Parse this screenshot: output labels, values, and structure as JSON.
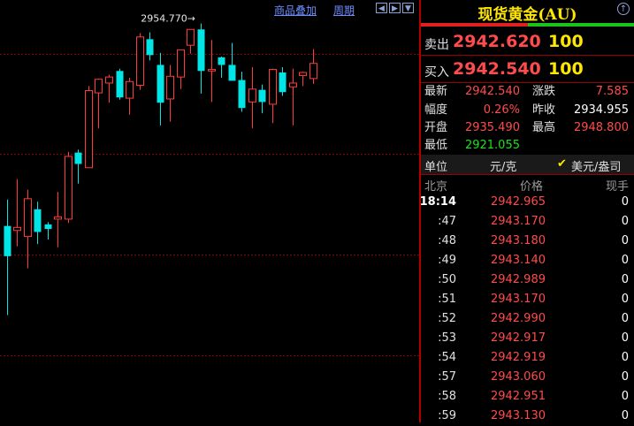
{
  "toolbar": {
    "overlay_label": "商品叠加",
    "period_label": "周期",
    "nav_left": "◀",
    "nav_right": "▶",
    "nav_down": "▼"
  },
  "chart": {
    "high_label": "2954.770→",
    "candles": [
      {
        "o": 2928.0,
        "h": 2931.5,
        "l": 2916.2,
        "c": 2924.0
      },
      {
        "o": 2927.4,
        "h": 2934.2,
        "l": 2925.3,
        "c": 2927.8
      },
      {
        "o": 2926.6,
        "h": 2932.8,
        "l": 2922.4,
        "c": 2931.6
      },
      {
        "o": 2930.2,
        "h": 2931.2,
        "l": 2925.6,
        "c": 2927.2
      },
      {
        "o": 2928.2,
        "h": 2928.5,
        "l": 2926.2,
        "c": 2927.6
      },
      {
        "o": 2928.9,
        "h": 2932.5,
        "l": 2925.2,
        "c": 2929.2
      },
      {
        "o": 2928.9,
        "h": 2937.8,
        "l": 2928.4,
        "c": 2937.2
      },
      {
        "o": 2937.7,
        "h": 2938.1,
        "l": 2933.6,
        "c": 2936.2
      },
      {
        "o": 2935.7,
        "h": 2946.5,
        "l": 2935.7,
        "c": 2945.9
      },
      {
        "o": 2945.6,
        "h": 2947.5,
        "l": 2940.9,
        "c": 2947.4
      },
      {
        "o": 2946.9,
        "h": 2948.0,
        "l": 2944.3,
        "c": 2947.7
      },
      {
        "o": 2948.5,
        "h": 2948.8,
        "l": 2944.7,
        "c": 2945.0
      },
      {
        "o": 2944.9,
        "h": 2947.6,
        "l": 2942.7,
        "c": 2947.1
      },
      {
        "o": 2946.6,
        "h": 2953.5,
        "l": 2946.0,
        "c": 2953.0
      },
      {
        "o": 2952.7,
        "h": 2953.6,
        "l": 2949.9,
        "c": 2950.6
      },
      {
        "o": 2949.3,
        "h": 2950.9,
        "l": 2941.3,
        "c": 2944.3
      },
      {
        "o": 2944.8,
        "h": 2949.3,
        "l": 2941.8,
        "c": 2947.8
      },
      {
        "o": 2947.7,
        "h": 2950.6,
        "l": 2946.1,
        "c": 2951.3
      },
      {
        "o": 2951.9,
        "h": 2953.6,
        "l": 2950.8,
        "c": 2954.0
      },
      {
        "o": 2954.0,
        "h": 2954.77,
        "l": 2945.5,
        "c": 2948.5
      },
      {
        "o": 2948.5,
        "h": 2952.6,
        "l": 2944.4,
        "c": 2948.7
      },
      {
        "o": 2950.3,
        "h": 2950.4,
        "l": 2947.6,
        "c": 2949.3
      },
      {
        "o": 2949.3,
        "h": 2952.2,
        "l": 2947.2,
        "c": 2947.2
      },
      {
        "o": 2947.3,
        "h": 2948.4,
        "l": 2943.1,
        "c": 2943.6
      },
      {
        "o": 2944.4,
        "h": 2949.0,
        "l": 2940.9,
        "c": 2946.1
      },
      {
        "o": 2946.0,
        "h": 2946.7,
        "l": 2942.9,
        "c": 2944.4
      },
      {
        "o": 2944.1,
        "h": 2948.8,
        "l": 2941.6,
        "c": 2948.7
      },
      {
        "o": 2948.3,
        "h": 2949.0,
        "l": 2945.2,
        "c": 2945.7
      },
      {
        "o": 2946.4,
        "h": 2948.8,
        "l": 2941.3,
        "c": 2946.9
      },
      {
        "o": 2947.9,
        "h": 2948.4,
        "l": 2946.5,
        "c": 2948.3
      },
      {
        "o": 2947.5,
        "h": 2951.4,
        "l": 2946.8,
        "c": 2949.5
      }
    ]
  },
  "panel": {
    "title": "现货黄金(AU)",
    "title_icon": "↑",
    "compare_bar": {
      "red_ratio": 0.5,
      "red_color": "#e02020",
      "green_color": "#1bc41b"
    },
    "sell": {
      "label": "卖出",
      "price": "2942.620",
      "volume": "100"
    },
    "buy": {
      "label": "买入",
      "price": "2942.540",
      "volume": "100"
    },
    "stats": {
      "latest_label": "最新",
      "latest": "2942.540",
      "change_label": "涨跌",
      "change": "7.585",
      "pct_label": "幅度",
      "pct": "0.26%",
      "prev_close_label": "昨收",
      "prev_close": "2934.955",
      "open_label": "开盘",
      "open": "2935.490",
      "high_label": "最高",
      "high": "2948.800",
      "low_label": "最低",
      "low": "2921.055"
    },
    "unit": {
      "label": "单位",
      "cny": "元/克",
      "check": "✔",
      "usd": "美元/盎司"
    },
    "tick_header": {
      "time": "北京",
      "price": "价格",
      "volume": "现手"
    },
    "ticks": [
      {
        "time": "18:14",
        "price": "2942.965",
        "volume": "0"
      },
      {
        "time": ":47",
        "price": "2943.170",
        "volume": "0"
      },
      {
        "time": ":48",
        "price": "2943.180",
        "volume": "0"
      },
      {
        "time": ":49",
        "price": "2943.140",
        "volume": "0"
      },
      {
        "time": ":50",
        "price": "2942.989",
        "volume": "0"
      },
      {
        "time": ":51",
        "price": "2943.170",
        "volume": "0"
      },
      {
        "time": ":52",
        "price": "2942.990",
        "volume": "0"
      },
      {
        "time": ":53",
        "price": "2942.917",
        "volume": "0"
      },
      {
        "time": ":54",
        "price": "2942.919",
        "volume": "0"
      },
      {
        "time": ":57",
        "price": "2943.060",
        "volume": "0"
      },
      {
        "time": ":58",
        "price": "2942.951",
        "volume": "0"
      },
      {
        "time": ":59",
        "price": "2943.130",
        "volume": "0"
      }
    ]
  },
  "colors": {
    "up": "#ff3b3b",
    "down": "#00e5e5",
    "grid": "#8a0000",
    "background": "#000000"
  }
}
